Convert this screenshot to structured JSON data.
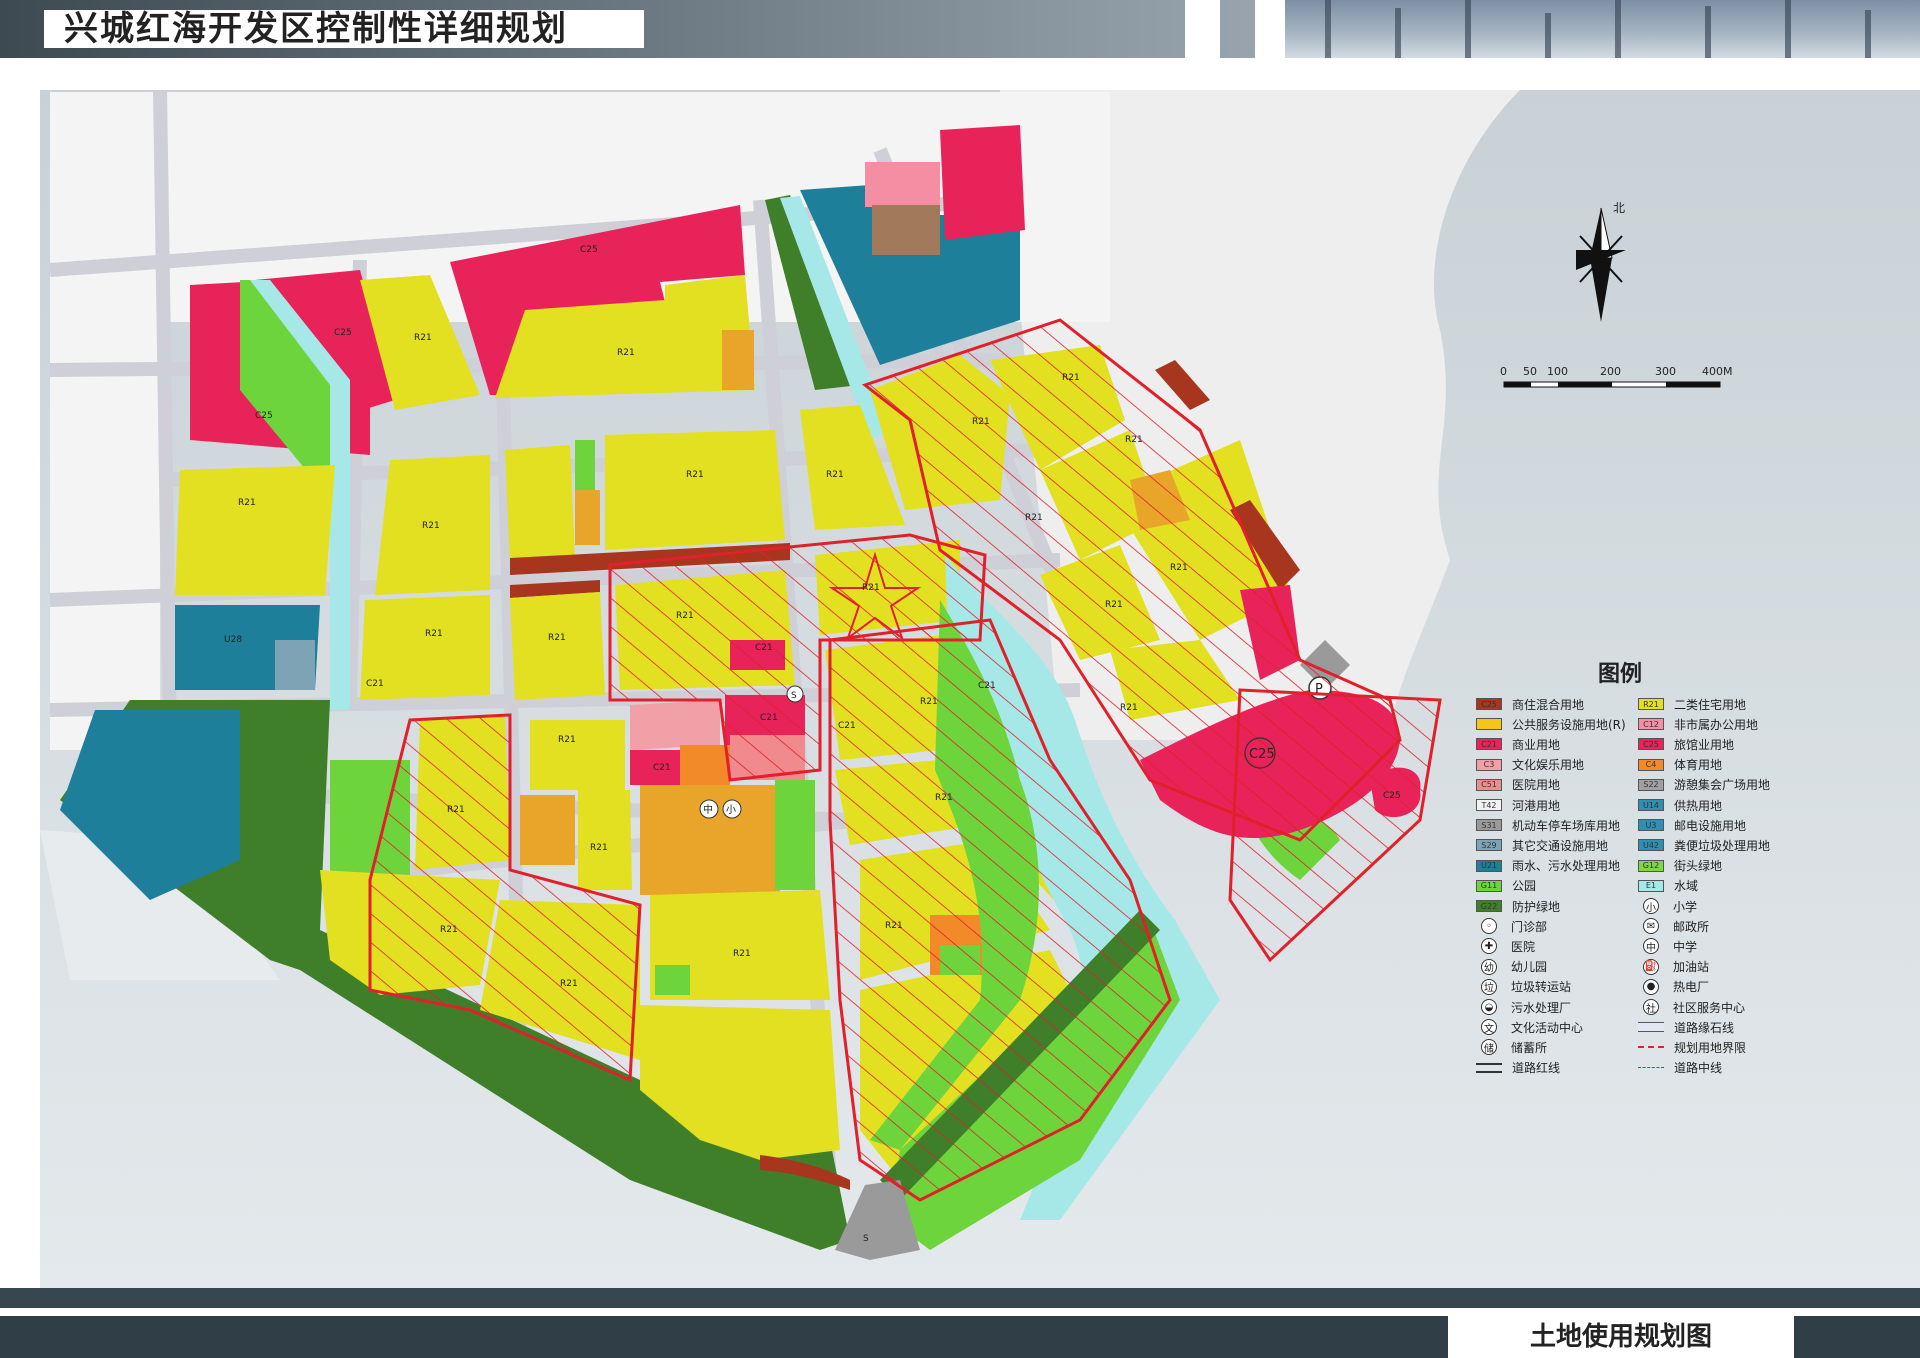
{
  "header": {
    "title": "兴城红海开发区控制性详细规划"
  },
  "footer": {
    "title": "土地使用规划图"
  },
  "compass": {
    "label": "北"
  },
  "scale": {
    "labels": [
      "0",
      "50",
      "100",
      "200",
      "300",
      "400M"
    ]
  },
  "map": {
    "labels": {
      "c25_top": "C25",
      "c25_left1": "C25",
      "c25_left2": "C25",
      "c25_bay": "C25",
      "c25_isle": "C25",
      "r21_a": "R21",
      "r21_b": "R21",
      "r21_c": "R21",
      "r21_d": "R21",
      "r21_e": "R21",
      "r21_f": "R21",
      "r21_g": "R21",
      "r21_h": "R21",
      "r21_i": "R21",
      "r21_j": "R21",
      "r21_k": "R21",
      "r21_l": "R21",
      "r21_m": "R21",
      "r21_n": "R21",
      "r21_o": "R21",
      "r21_p": "R21",
      "r21_q": "R21",
      "r21_r": "R21",
      "r21_s": "R21",
      "r21_t": "R21",
      "r21_u": "R21",
      "r21_v": "R21",
      "r21_w": "R21",
      "r21_x": "R21",
      "r21_y": "R21",
      "r21_z": "R21",
      "c21_a": "C21",
      "c21_b": "C21",
      "c21_c": "C21",
      "c21_d": "C21",
      "c21_e": "C21",
      "c21_f": "C21",
      "u28": "U28",
      "middle_school": "中",
      "primary_school": "小",
      "parking": "P",
      "pump_a": "S",
      "pump_b": "S"
    }
  },
  "legend": {
    "title": "图例",
    "left": [
      {
        "code": "C25",
        "label": "商住混合用地",
        "color": "#a8361f"
      },
      {
        "code": "",
        "label": "公共服务设施用地(R)",
        "color": "#f5c518"
      },
      {
        "code": "C21",
        "label": "商业用地",
        "color": "#e8235a"
      },
      {
        "code": "C3",
        "label": "文化娱乐用地",
        "color": "#f2a0a8"
      },
      {
        "code": "C51",
        "label": "医院用地",
        "color": "#f08a8c"
      },
      {
        "code": "T42",
        "label": "河港用地",
        "color": "#f3f3f3"
      },
      {
        "code": "S31",
        "label": "机动车停车场库用地",
        "color": "#9a9a9a"
      },
      {
        "code": "S29",
        "label": "其它交通设施用地",
        "color": "#7ea3b5"
      },
      {
        "code": "U21",
        "label": "雨水、污水处理用地",
        "color": "#1e7f9a"
      },
      {
        "code": "G11",
        "label": "公园",
        "color": "#6ed43c"
      },
      {
        "code": "G22",
        "label": "防护绿地",
        "color": "#3f7f2a"
      },
      {
        "symbol": "◦",
        "label": "门诊部"
      },
      {
        "symbol": "✚",
        "label": "医院"
      },
      {
        "symbol": "幼",
        "label": "幼儿园"
      },
      {
        "symbol": "垃",
        "label": "垃圾转运站"
      },
      {
        "symbol": "◒",
        "label": "污水处理厂"
      },
      {
        "symbol": "文",
        "label": "文化活动中心"
      },
      {
        "symbol": "储",
        "label": "储蓄所"
      },
      {
        "line": "double",
        "label": "道路红线"
      }
    ],
    "right": [
      {
        "code": "R21",
        "label": "二类住宅用地",
        "color": "#e2e020"
      },
      {
        "code": "C12",
        "label": "非市属办公用地",
        "color": "#f48fa3"
      },
      {
        "code": "C25",
        "label": "旅馆业用地",
        "color": "#e8235a"
      },
      {
        "code": "C4",
        "label": "体育用地",
        "color": "#f28a2a"
      },
      {
        "code": "S22",
        "label": "游憩集会广场用地",
        "color": "#a0a0a0"
      },
      {
        "code": "U14",
        "label": "供热用地",
        "color": "#2f8fb0"
      },
      {
        "code": "U3",
        "label": "邮电设施用地",
        "color": "#2f8fb0"
      },
      {
        "code": "U42",
        "label": "粪便垃圾处理用地",
        "color": "#2f8fb0"
      },
      {
        "code": "G12",
        "label": "街头绿地",
        "color": "#7fd64a"
      },
      {
        "code": "E1",
        "label": "水域",
        "color": "#a6e8e8"
      },
      {
        "symbol": "小",
        "label": "小学"
      },
      {
        "symbol": "✉",
        "label": "邮政所"
      },
      {
        "symbol": "中",
        "label": "中学"
      },
      {
        "symbol": "⛽",
        "label": "加油站"
      },
      {
        "symbol": "●",
        "label": "热电厂"
      },
      {
        "symbol": "社",
        "label": "社区服务中心"
      },
      {
        "line": "curb",
        "label": "道路缘石线"
      },
      {
        "line": "boundary",
        "label": "规划用地界限"
      },
      {
        "line": "center",
        "label": "道路中线"
      }
    ]
  }
}
